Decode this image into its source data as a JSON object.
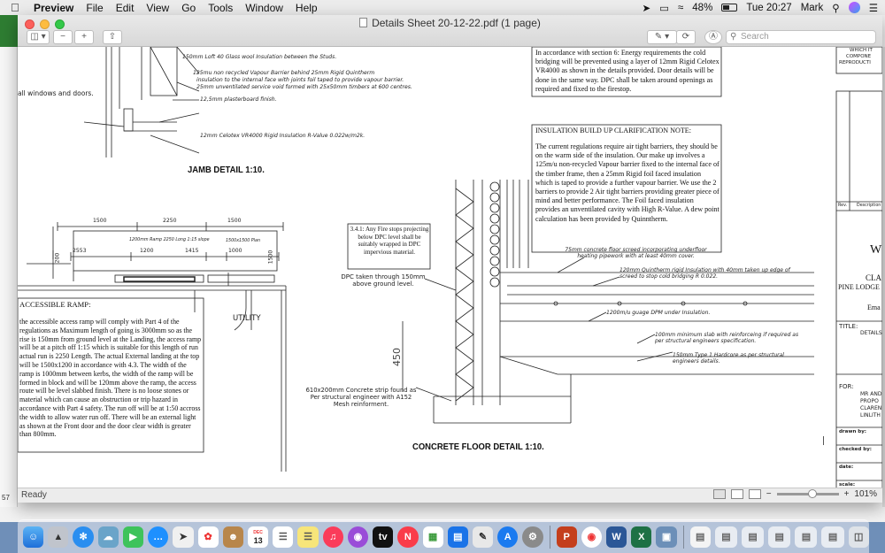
{
  "menubar": {
    "app_name": "Preview",
    "items": [
      "File",
      "Edit",
      "View",
      "Go",
      "Tools",
      "Window",
      "Help"
    ],
    "battery": "48%",
    "clock": "Tue 20:27",
    "user": "Mark"
  },
  "window": {
    "title": "Details Sheet 20-12-22.pdf (1 page)",
    "search_placeholder": "Search"
  },
  "status": {
    "ready": "Ready",
    "zoom_label": "101%",
    "zoom_fraction": 0.58
  },
  "drawing": {
    "jamb_notes": [
      "150mm Loft 40 Glass wool Insulation between the Studs.",
      "125mu non recycled Vapour Barrier behind 25mm Rigid Quintherm",
      "insulation to the internal face with joints foil taped to provide vapour barrier.",
      "25mm unventilated service void formed with 25x50mm timbers at 600 centres.",
      "12,5mm plasterboard finish.",
      "12mm Celotex VR4000 Rigid Insulation R-Value 0.022w/m2k."
    ],
    "windows_doors": "all windows and doors.",
    "jamb_title": "JAMB DETAIL 1:10.",
    "ramp_dims_top": [
      "1500",
      "2250",
      "1500"
    ],
    "ramp_dims_mid": [
      "2553",
      "1200",
      "1415",
      "1000"
    ],
    "ramp_dim_side": "200",
    "ramp_dim_right": "1500",
    "ramp_label": "1200mm Ramp 2250 Long 1:15 slope",
    "landing_label": "1500x1500 Plan",
    "utility": "UTILITY",
    "accessible_title": "ACCESSIBLE RAMP:",
    "accessible_text": "the accessible access ramp will comply with Part 4 of the regulations as Maximum length of going is 3000mm so as the rise is 150mm from ground level at the Landing, the access ramp will be at a pitch off 1:15 which is suitable for this length of run actual run is 2250 Length. The actual External landing at the top will be 1500x1200 in accordance with 4.3. The width of the ramp is 1000mm between kerbs, the width of the ramp will be formed in block and will be 120mm above the ramp, the access route will be level slabbed finish. There is no loose stones or material which can cause an obstruction or trip hazard in accordance with Part 4 safety. The run off will be at 1:50 accross the width to allow water run off. There will be an external light as shown at the Front door and the door clear width is greater than 800mm.",
    "fire_stops": "3.4.1: Any Fire stops projecting below DPC level shall be suitably wrapped in DPC impervious material.",
    "energy_note": "In accordance with section 6: Energy requirements the cold bridging will be prevented using a layer of 12mm Rigid Celotex VR4000 as shown in the details provided. Door details will be done in the same way. DPC shall be taken around openings as required and fixed to the firestop.",
    "insulation_title": "INSULATION BUILD UP CLARIFICATION NOTE:",
    "insulation_text": "The current regulations require air tight barriers, they should be on the warm side of the insulation. Our make up involves a 125m/u non-recycled Vapour barrier fixed to the internal face of the timber frame, then a 25mm Rigid foil faced insulation which is taped to provide a further vapour barrier. We use the 2 barriers to provide 2 Air tight barriers providing greater piece of mind and better performance. The Foil faced insulation provides an unventilated cavity with High R-Value. A dew point calculation has been provided by Quinntherm.",
    "dpc_note": "DPC taken through 150mm above ground level.",
    "dim_450": "450",
    "strip_note": "610x200mm Concrete strip found as Per structural engineer with A152 Mesh reinforment.",
    "floor_notes": [
      "75mm concrete floor screed incorporating underfloor heating pipework with at least 40mm cover.",
      "120mm Quintherm rigid Insulation with 40mm taken up edge of screed to stop cold bridging R 0.022.",
      "1200m/u guage DPM under Insulation.",
      "100mm minimum slab with reinforceing if required as per structural engineers specification.",
      "150mm Type 1 Hardcore as per structural engineers details."
    ],
    "floor_title": "CONCRETE FLOOR DETAIL 1:10.",
    "titleblock": {
      "top_text": [
        "WHICH IT",
        "COMPONE",
        "REPRODUCTI"
      ],
      "rev": "Rev.",
      "description": "Description",
      "w": "W",
      "cla": "CLA",
      "pine": "PINE LODGE",
      "ema": "Ema",
      "title_label": "TITLE:",
      "title_value": "DETAILS",
      "for_label": "FOR:",
      "for_lines": [
        "MR AND",
        "PROPO",
        "CLAREN",
        "LINLITH"
      ],
      "drawn_by": "drawn by:",
      "checked_by": "checked by:",
      "date": "date:",
      "scale": "scale:"
    }
  },
  "dock": {
    "calendar_day": "13",
    "calendar_month": "DEC",
    "tv_label": "tv"
  },
  "bg_sheet": {
    "row_label": "57"
  }
}
